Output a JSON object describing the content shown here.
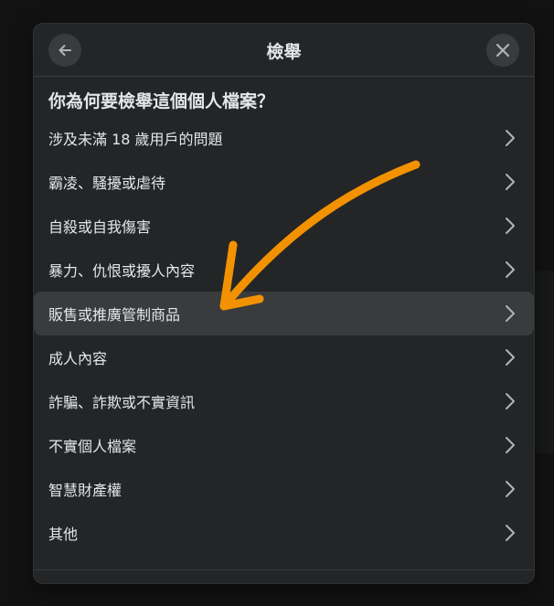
{
  "dialog": {
    "title": "檢舉",
    "question": "你為何要檢舉這個個人檔案？",
    "back_icon": "arrow-left-icon",
    "close_icon": "close-icon",
    "items": [
      {
        "label": "涉及未滿 18 歲用戶的問題"
      },
      {
        "label": "霸凌、騷擾或虐待"
      },
      {
        "label": "自殺或自我傷害"
      },
      {
        "label": "暴力、仇恨或擾人內容"
      },
      {
        "label": "販售或推廣管制商品",
        "highlighted": true
      },
      {
        "label": "成人內容"
      },
      {
        "label": "詐騙、詐欺或不實資訊"
      },
      {
        "label": "不實個人檔案"
      },
      {
        "label": "智慧財產權"
      },
      {
        "label": "其他"
      }
    ]
  },
  "colors": {
    "dialog_bg": "#242526",
    "highlight_bg": "#3a3b3c",
    "text": "#e4e6eb",
    "annotation_arrow": "#f39200"
  }
}
